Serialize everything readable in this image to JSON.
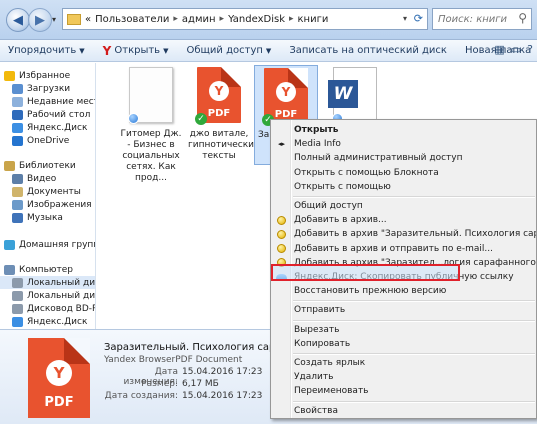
{
  "window": {
    "breadcrumb": [
      "«",
      "Пользователи",
      "админ",
      "YandexDisk",
      "книги"
    ],
    "search_placeholder": "Поиск: книги"
  },
  "toolbar": {
    "organize": "Упорядочить",
    "open": "Открыть",
    "share": "Общий доступ",
    "burn": "Записать на оптический диск",
    "new_folder": "Новая папка"
  },
  "sidebar": {
    "items": [
      {
        "label": "Избранное",
        "icon": "star-icon",
        "color": "#f2b90c"
      },
      {
        "label": "Загрузки",
        "icon": "downloads-icon",
        "color": "#5a8fd0"
      },
      {
        "label": "Недавние места",
        "icon": "recent-places-icon",
        "color": "#8db1dc"
      },
      {
        "label": "Рабочий стол",
        "icon": "desktop-icon",
        "color": "#2f6bbb"
      },
      {
        "label": "Яндекс.Диск",
        "icon": "yandex-disk-icon",
        "color": "#3c8fe3"
      },
      {
        "label": "OneDrive",
        "icon": "onedrive-icon",
        "color": "#2474cf"
      },
      {
        "label": "Библиотеки",
        "icon": "libraries-icon",
        "color": "#c9a44a"
      },
      {
        "label": "Видео",
        "icon": "video-icon",
        "color": "#5d7fa8"
      },
      {
        "label": "Документы",
        "icon": "documents-icon",
        "color": "#d0b46b"
      },
      {
        "label": "Изображения",
        "icon": "pictures-icon",
        "color": "#6c9ac9"
      },
      {
        "label": "Музыка",
        "icon": "music-icon",
        "color": "#3f73b9"
      },
      {
        "label": "Домашняя группа",
        "icon": "homegroup-icon",
        "color": "#3aa1d8"
      },
      {
        "label": "Компьютер",
        "icon": "computer-icon",
        "color": "#6d8eb5"
      },
      {
        "label": "Локальный диск",
        "icon": "local-disk-icon",
        "color": "#8c9aab"
      },
      {
        "label": "Локальный диск",
        "icon": "local-disk-icon",
        "color": "#8c9aab"
      },
      {
        "label": "Дисковод BD-RO",
        "icon": "bd-drive-icon",
        "color": "#8c9aab"
      },
      {
        "label": "Яндекс.Диск",
        "icon": "yandex-disk-icon",
        "color": "#3c8fe3"
      }
    ]
  },
  "files": [
    {
      "name": "Гитомер Дж. - Бизнес в социальных сетях. Как прод...",
      "type": "blank",
      "badge": "sync"
    },
    {
      "name": "джо витале, гипнотические тексты",
      "type": "pdf",
      "badge": "ok"
    },
    {
      "name": "Зар П с",
      "type": "pdf",
      "badge": "ok",
      "selected": true
    },
    {
      "name": "",
      "type": "word",
      "badge": "sync"
    }
  ],
  "pdf_label": "PDF",
  "details": {
    "title": "Заразительный. Психология сарафанного р",
    "type": "Yandex BrowserPDF Document",
    "modified_key": "Дата изменения:",
    "modified": "15.04.2016 17:23",
    "size_key": "Размер:",
    "size": "6,17 МБ",
    "created_key": "Дата создания:",
    "created": "15.04.2016 17:23"
  },
  "context_menu": {
    "items": [
      {
        "label": "Открыть",
        "bold": true,
        "icon": ""
      },
      {
        "label": "Media Info",
        "icon": "media-info-icon"
      },
      {
        "label": "Полный административный доступ",
        "icon": ""
      },
      {
        "label": "Открыть с помощью Блокнота",
        "icon": ""
      },
      {
        "label": "Открыть с помощью",
        "icon": ""
      },
      {
        "sep": true
      },
      {
        "label": "Общий доступ",
        "icon": ""
      },
      {
        "label": "Добавить в архив...",
        "icon": "archive-icon"
      },
      {
        "label": "Добавить в архив \"Заразительный. Психология сарафанного радио.rar\"",
        "icon": "archive-icon"
      },
      {
        "label": "Добавить в архив и отправить по e-mail...",
        "icon": "archive-icon"
      },
      {
        "label": "Добавить в архив \"Заразител...логия сарафанного радио.rar\" и отправи",
        "icon": "archive-icon"
      },
      {
        "label": "Яндекс.Диск: Скопировать публичную ссылку",
        "icon": "yandex-disk-icon",
        "highlighted": true
      },
      {
        "label": "Восстановить прежнюю версию",
        "icon": ""
      },
      {
        "sep": true
      },
      {
        "label": "Отправить",
        "icon": ""
      },
      {
        "sep": true
      },
      {
        "label": "Вырезать",
        "icon": ""
      },
      {
        "label": "Копировать",
        "icon": ""
      },
      {
        "sep": true
      },
      {
        "label": "Создать ярлык",
        "icon": ""
      },
      {
        "label": "Удалить",
        "icon": ""
      },
      {
        "label": "Переименовать",
        "icon": ""
      },
      {
        "sep": true
      },
      {
        "label": "Свойства",
        "icon": ""
      }
    ]
  },
  "colors": {
    "accent": "#3c8fe3",
    "pdf": "#e8532f",
    "highlight": "#e0212b"
  }
}
